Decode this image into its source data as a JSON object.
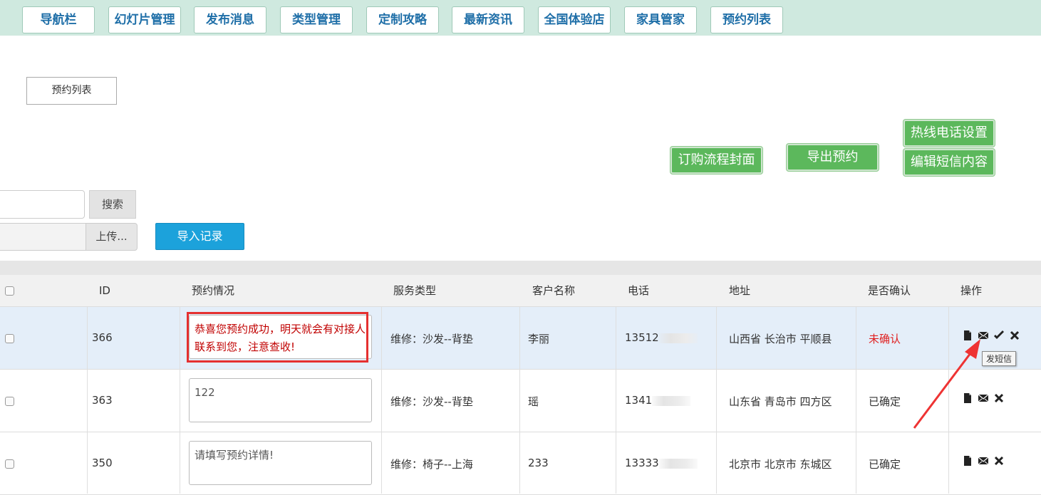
{
  "nav": [
    "导航栏",
    "幻灯片管理",
    "发布消息",
    "类型管理",
    "定制攻略",
    "最新资讯",
    "全国体验店",
    "家具管家",
    "预约列表"
  ],
  "page_label": "预约列表",
  "actions": {
    "hotline": "热线电话设置",
    "order_cover": "订购流程封面",
    "export": "导出预约",
    "sms_edit": "编辑短信内容"
  },
  "search": {
    "button": "搜索",
    "value": ""
  },
  "upload": {
    "button": "上传...",
    "import": "导入记录"
  },
  "table": {
    "headers": [
      "ID",
      "预约情况",
      "服务类型",
      "客户名称",
      "电话",
      "地址",
      "是否确认",
      "操作"
    ],
    "rows": [
      {
        "id": "366",
        "note": "恭喜您预约成功，明天就会有对接人联系到您，注意查收!",
        "service": "维修：沙发--背垫",
        "name": "李丽",
        "phone_visible": "13512",
        "address": "山西省 长治市 平顺县",
        "status": "未确认"
      },
      {
        "id": "363",
        "note": "122",
        "service": "维修：沙发--背垫",
        "name": "瑶",
        "phone_visible": "1341",
        "address": "山东省 青岛市 四方区",
        "status": "已确定"
      },
      {
        "id": "350",
        "note": "请填写预约详情!",
        "service": "维修：椅子--上海",
        "name": "233",
        "phone_visible": "13333",
        "address": "北京市 北京市 东城区",
        "status": "已确定"
      }
    ]
  },
  "tooltip": "发短信",
  "colors": {
    "nav_bg": "#cfe9df",
    "green": "#5cb85c",
    "blue": "#1ca2db",
    "red": "#e53030",
    "highlight_row": "#e4eef9"
  },
  "icons": [
    "file-icon",
    "envelope-icon",
    "check-icon",
    "close-icon",
    "arrow-annotation"
  ]
}
